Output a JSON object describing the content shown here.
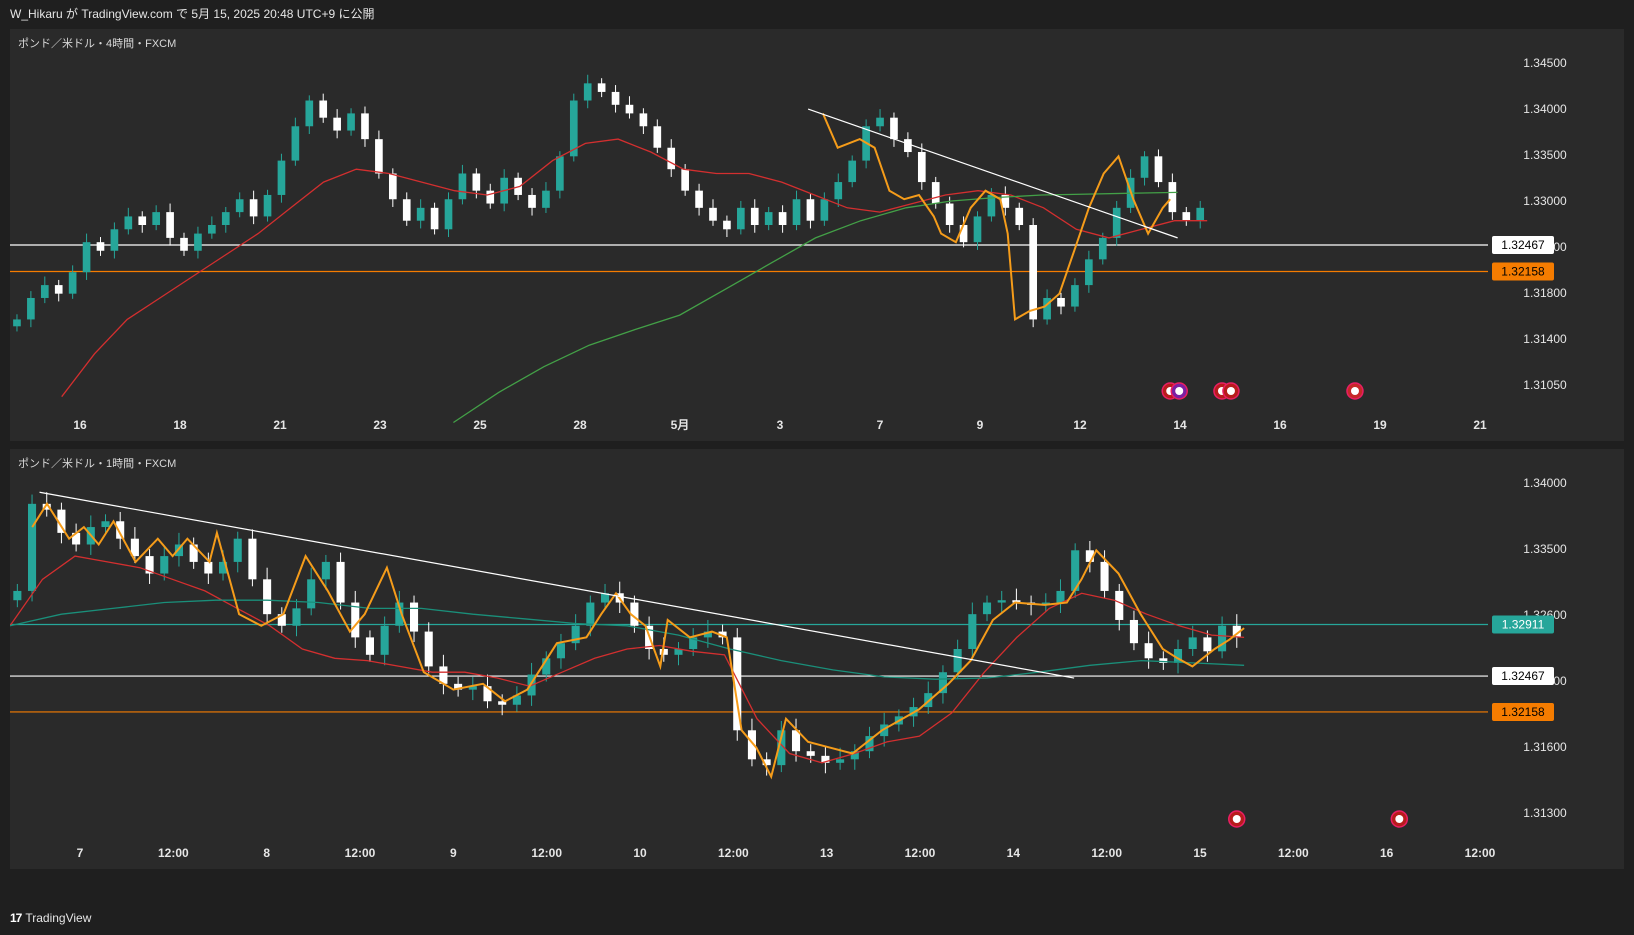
{
  "header": {
    "publish_text": "W_Hikaru が TradingView.com で 5月 15, 2025 20:48 UTC+9 に公開"
  },
  "footer": {
    "brand": "TradingView",
    "logo_glyph": "17"
  },
  "colors": {
    "bg": "#2a2a2a",
    "up": "#26a69a",
    "down": "#ffffff",
    "ma_red": "#d32f2f",
    "ma_green": "#43a047",
    "ma_teal": "#1a8f7a",
    "zigzag": "#f59c1a",
    "line_white": "#ffffff",
    "line_orange": "#f57c00"
  },
  "chart_data": [
    {
      "type": "candlestick",
      "title": "ポンド／米ドル・4時間・FXCM",
      "ylim": [
        1.3065,
        1.3475
      ],
      "y_ticks": [
        "1.34500",
        "1.34000",
        "1.33500",
        "1.33000",
        "1.32600",
        "1.31800",
        "1.31400",
        "1.31050"
      ],
      "x_labels": [
        "16",
        "18",
        "21",
        "23",
        "25",
        "28",
        "5月",
        "3",
        "7",
        "9",
        "12",
        "14",
        "16",
        "19",
        "21"
      ],
      "price_tags": [
        {
          "value": "1.32467",
          "color": "#ffffff",
          "text_color": "#000000"
        },
        {
          "value": "1.32158",
          "color": "#f57c00",
          "text_color": "#000000"
        }
      ],
      "horizontal_lines": [
        {
          "value": 1.32467,
          "color": "#ffffff"
        },
        {
          "value": 1.32158,
          "color": "#f57c00"
        }
      ],
      "trendline": {
        "from": [
          0.54,
          1.3405
        ],
        "to": [
          0.79,
          1.3255
        ],
        "color": "#ffffff"
      },
      "candle_range": [
        0.0,
        0.81
      ],
      "closes": [
        1.316,
        1.3185,
        1.32,
        1.319,
        1.3215,
        1.325,
        1.324,
        1.3265,
        1.328,
        1.327,
        1.3285,
        1.3255,
        1.324,
        1.326,
        1.327,
        1.3285,
        1.33,
        1.328,
        1.3305,
        1.3345,
        1.3385,
        1.3415,
        1.3395,
        1.338,
        1.34,
        1.337,
        1.333,
        1.33,
        1.3275,
        1.329,
        1.3265,
        1.33,
        1.333,
        1.331,
        1.3295,
        1.3325,
        1.3305,
        1.329,
        1.331,
        1.335,
        1.3415,
        1.3435,
        1.3425,
        1.341,
        1.34,
        1.3385,
        1.336,
        1.3335,
        1.331,
        1.329,
        1.3275,
        1.3265,
        1.329,
        1.327,
        1.3285,
        1.327,
        1.33,
        1.3275,
        1.33,
        1.332,
        1.3345,
        1.3385,
        1.3395,
        1.337,
        1.3355,
        1.332,
        1.3295,
        1.327,
        1.325,
        1.328,
        1.3305,
        1.329,
        1.327,
        1.316,
        1.3185,
        1.3175,
        1.32,
        1.323,
        1.3255,
        1.329,
        1.3325,
        1.335,
        1.332,
        1.3285,
        1.3275,
        1.329
      ],
      "ma_red": [
        1.307,
        1.312,
        1.316,
        1.3185,
        1.321,
        1.3235,
        1.326,
        1.329,
        1.332,
        1.3335,
        1.333,
        1.332,
        1.331,
        1.3305,
        1.3315,
        1.3345,
        1.3365,
        1.337,
        1.3355,
        1.3335,
        1.333,
        1.333,
        1.332,
        1.3305,
        1.329,
        1.3285,
        1.3295,
        1.3305,
        1.331,
        1.3305,
        1.329,
        1.3265,
        1.3255,
        1.3265,
        1.3275,
        1.3275
      ],
      "ma_green": [
        1.304,
        1.3075,
        1.3105,
        1.313,
        1.3148,
        1.3165,
        1.3195,
        1.3225,
        1.3255,
        1.3275,
        1.329,
        1.3298,
        1.3302,
        1.3305,
        1.3306,
        1.3307,
        1.3308
      ],
      "ma_green_range": [
        0.3,
        0.79
      ],
      "zigzag": [
        [
          0.55,
          1.34
        ],
        [
          0.56,
          1.336
        ],
        [
          0.575,
          1.337
        ],
        [
          0.585,
          1.336
        ],
        [
          0.595,
          1.331
        ],
        [
          0.605,
          1.33
        ],
        [
          0.615,
          1.3305
        ],
        [
          0.625,
          1.328
        ],
        [
          0.63,
          1.326
        ],
        [
          0.64,
          1.325
        ],
        [
          0.65,
          1.329
        ],
        [
          0.66,
          1.331
        ],
        [
          0.67,
          1.33
        ],
        [
          0.675,
          1.326
        ],
        [
          0.68,
          1.316
        ],
        [
          0.69,
          1.317
        ],
        [
          0.7,
          1.3175
        ],
        [
          0.71,
          1.319
        ],
        [
          0.72,
          1.324
        ],
        [
          0.73,
          1.329
        ],
        [
          0.74,
          1.333
        ],
        [
          0.75,
          1.335
        ],
        [
          0.76,
          1.33
        ],
        [
          0.77,
          1.326
        ],
        [
          0.78,
          1.329
        ],
        [
          0.785,
          1.33
        ]
      ],
      "events_row": [
        {
          "x": 0.785,
          "icons": [
            "us-flag",
            "lightning"
          ]
        },
        {
          "x": 0.82,
          "icons": [
            "us-flag",
            "us-flag"
          ]
        },
        {
          "x": 0.91,
          "icons": [
            "uk-flag"
          ]
        }
      ]
    },
    {
      "type": "candlestick",
      "title": "ポンド／米ドル・1時間・FXCM",
      "ylim": [
        1.3115,
        1.3425
      ],
      "y_ticks": [
        "1.34000",
        "1.33500",
        "1.32600",
        "1.31900",
        "1.31600",
        "1.31300"
      ],
      "x_labels": [
        "7",
        "12:00",
        "8",
        "12:00",
        "9",
        "12:00",
        "10",
        "12:00",
        "13",
        "12:00",
        "14",
        "12:00",
        "15",
        "12:00",
        "16",
        "12:00"
      ],
      "price_tags": [
        {
          "value": "1.32911",
          "color": "#26a69a",
          "text_color": "#ffffff"
        },
        {
          "value": "1.32467",
          "color": "#ffffff",
          "text_color": "#000000"
        },
        {
          "value": "1.32158",
          "color": "#f57c00",
          "text_color": "#000000"
        }
      ],
      "horizontal_lines": [
        {
          "value": 1.32911,
          "color": "#26a69a"
        },
        {
          "value": 1.32467,
          "color": "#ffffff"
        },
        {
          "value": 1.32158,
          "color": "#f57c00"
        }
      ],
      "trendline": {
        "from": [
          0.02,
          1.3405
        ],
        "to": [
          0.72,
          1.3245
        ],
        "color": "#ffffff"
      },
      "candle_range": [
        0.0,
        0.835
      ],
      "closes": [
        1.332,
        1.3395,
        1.339,
        1.337,
        1.336,
        1.3375,
        1.338,
        1.3365,
        1.335,
        1.3335,
        1.335,
        1.336,
        1.3345,
        1.3335,
        1.3345,
        1.3365,
        1.333,
        1.33,
        1.329,
        1.3305,
        1.333,
        1.3345,
        1.331,
        1.328,
        1.3265,
        1.329,
        1.331,
        1.3285,
        1.3255,
        1.324,
        1.3235,
        1.3238,
        1.3225,
        1.3222,
        1.323,
        1.3248,
        1.3262,
        1.3275,
        1.329,
        1.331,
        1.3318,
        1.331,
        1.329,
        1.327,
        1.3265,
        1.327,
        1.328,
        1.3285,
        1.328,
        1.32,
        1.3175,
        1.317,
        1.32,
        1.3182,
        1.3178,
        1.3172,
        1.3175,
        1.3182,
        1.3195,
        1.3205,
        1.3212,
        1.322,
        1.3232,
        1.325,
        1.327,
        1.33,
        1.331,
        1.3312,
        1.331,
        1.3308,
        1.331,
        1.332,
        1.3355,
        1.3345,
        1.332,
        1.3295,
        1.3275,
        1.3262,
        1.3258,
        1.327,
        1.328,
        1.3268,
        1.329,
        1.328
      ],
      "ma_red": [
        1.329,
        1.333,
        1.335,
        1.3345,
        1.334,
        1.333,
        1.332,
        1.3305,
        1.329,
        1.327,
        1.3262,
        1.326,
        1.3255,
        1.325,
        1.325,
        1.3245,
        1.3238,
        1.325,
        1.3262,
        1.327,
        1.3273,
        1.3268,
        1.3265,
        1.321,
        1.318,
        1.3172,
        1.318,
        1.319,
        1.3195,
        1.3215,
        1.325,
        1.328,
        1.3305,
        1.3318,
        1.3312,
        1.33,
        1.329,
        1.3282,
        1.328
      ],
      "ma_teal": [
        1.329,
        1.33,
        1.3305,
        1.331,
        1.3312,
        1.3312,
        1.331,
        1.3305,
        1.3305,
        1.33,
        1.3296,
        1.3292,
        1.329,
        1.3282,
        1.327,
        1.326,
        1.3252,
        1.3246,
        1.3244,
        1.3245,
        1.325,
        1.3256,
        1.326,
        1.3258,
        1.3256
      ],
      "zigzag": [
        [
          0.015,
          1.3375
        ],
        [
          0.025,
          1.3395
        ],
        [
          0.04,
          1.3365
        ],
        [
          0.05,
          1.3375
        ],
        [
          0.06,
          1.336
        ],
        [
          0.07,
          1.338
        ],
        [
          0.085,
          1.3345
        ],
        [
          0.1,
          1.3365
        ],
        [
          0.11,
          1.335
        ],
        [
          0.12,
          1.3365
        ],
        [
          0.135,
          1.3345
        ],
        [
          0.14,
          1.337
        ],
        [
          0.155,
          1.33
        ],
        [
          0.17,
          1.329
        ],
        [
          0.185,
          1.33
        ],
        [
          0.2,
          1.335
        ],
        [
          0.215,
          1.332
        ],
        [
          0.23,
          1.3285
        ],
        [
          0.24,
          1.33
        ],
        [
          0.255,
          1.334
        ],
        [
          0.265,
          1.33
        ],
        [
          0.28,
          1.325
        ],
        [
          0.3,
          1.3235
        ],
        [
          0.32,
          1.324
        ],
        [
          0.335,
          1.3225
        ],
        [
          0.35,
          1.3235
        ],
        [
          0.37,
          1.3275
        ],
        [
          0.39,
          1.328
        ],
        [
          0.4,
          1.33
        ],
        [
          0.41,
          1.3318
        ],
        [
          0.42,
          1.33
        ],
        [
          0.43,
          1.329
        ],
        [
          0.44,
          1.3255
        ],
        [
          0.445,
          1.3295
        ],
        [
          0.46,
          1.328
        ],
        [
          0.475,
          1.3285
        ],
        [
          0.485,
          1.328
        ],
        [
          0.495,
          1.32
        ],
        [
          0.505,
          1.3185
        ],
        [
          0.515,
          1.316
        ],
        [
          0.525,
          1.321
        ],
        [
          0.54,
          1.319
        ],
        [
          0.555,
          1.3185
        ],
        [
          0.57,
          1.318
        ],
        [
          0.59,
          1.32
        ],
        [
          0.615,
          1.3218
        ],
        [
          0.635,
          1.324
        ],
        [
          0.65,
          1.326
        ],
        [
          0.665,
          1.3295
        ],
        [
          0.68,
          1.331
        ],
        [
          0.7,
          1.3308
        ],
        [
          0.715,
          1.331
        ],
        [
          0.725,
          1.333
        ],
        [
          0.735,
          1.3355
        ],
        [
          0.75,
          1.3335
        ],
        [
          0.765,
          1.33
        ],
        [
          0.78,
          1.327
        ],
        [
          0.79,
          1.3262
        ],
        [
          0.8,
          1.3255
        ],
        [
          0.815,
          1.327
        ],
        [
          0.825,
          1.3278
        ],
        [
          0.835,
          1.3288
        ]
      ],
      "events_row": [
        {
          "x": 0.83,
          "icons": [
            "us-flag"
          ]
        },
        {
          "x": 0.94,
          "icons": [
            "us-flag"
          ]
        }
      ]
    }
  ]
}
